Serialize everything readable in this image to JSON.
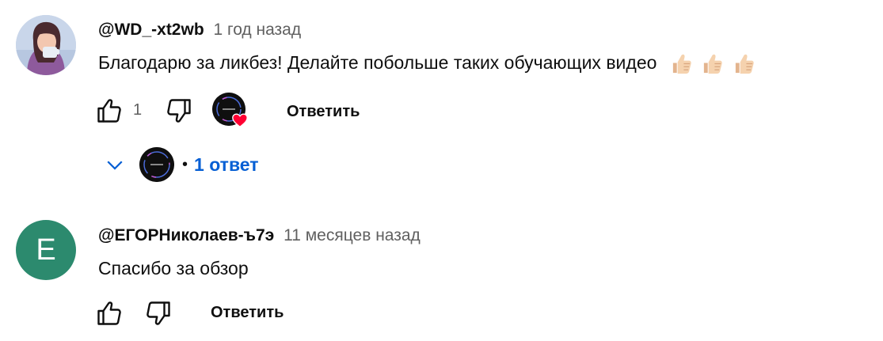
{
  "comments": [
    {
      "author": "@WD_-xt2wb",
      "time": "1 год назад",
      "text": "Благодарю за ликбез! Делайте побольше таких обучающих видео",
      "emoji": [
        "thumbs-up-emoji",
        "thumbs-up-emoji",
        "thumbs-up-emoji"
      ],
      "like_count": "1",
      "reply_label": "Ответить",
      "replies_label": "1 ответ",
      "dot": "•"
    },
    {
      "author": "@ЕГОРНиколаев-ъ7э",
      "time": "11 месяцев назад",
      "avatar_letter": "E",
      "text": "Спасибо за обзор",
      "reply_label": "Ответить"
    }
  ],
  "icons": {
    "like": "thumb-up-outline-icon",
    "dislike": "thumb-down-outline-icon",
    "chevron": "chevron-down-icon",
    "heart": "heart-icon"
  },
  "colors": {
    "link_blue": "#065fd4",
    "heart_red": "#ff0033",
    "avatar_green": "#2c8a6e"
  }
}
